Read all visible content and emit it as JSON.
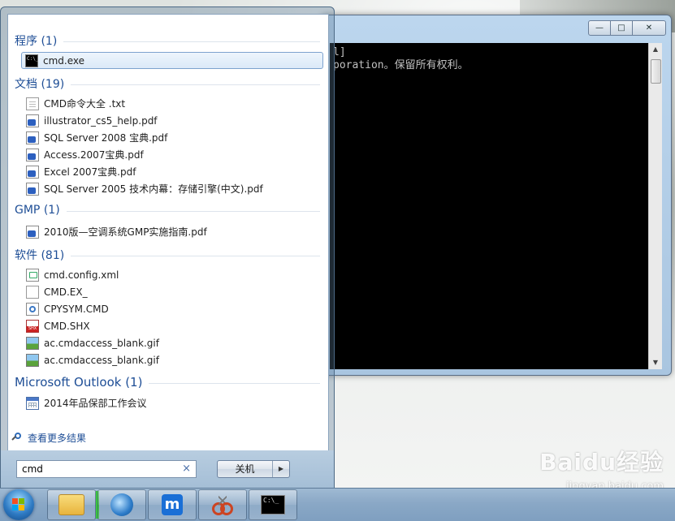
{
  "cmd_window": {
    "console_lines": [
      "l]",
      "poration。保留所有权利。"
    ],
    "controls": [
      "—",
      "□",
      "✕"
    ]
  },
  "start_menu": {
    "groups": [
      {
        "header": "程序 (1)",
        "items": [
          {
            "label": "cmd.exe",
            "icon": "cmd-icon",
            "selected": true
          }
        ]
      },
      {
        "header": "文档 (19)",
        "items": [
          {
            "label": "CMD命令大全 .txt",
            "icon": "text-file-icon"
          },
          {
            "label": "illustrator_cs5_help.pdf",
            "icon": "pdf-file-icon"
          },
          {
            "label": "SQL Server 2008 宝典.pdf",
            "icon": "pdf-file-icon"
          },
          {
            "label": "Access.2007宝典.pdf",
            "icon": "pdf-file-icon"
          },
          {
            "label": "Excel 2007宝典.pdf",
            "icon": "pdf-file-icon"
          },
          {
            "label": "SQL Server 2005 技术内幕：存储引擎(中文).pdf",
            "icon": "pdf-file-icon"
          }
        ]
      },
      {
        "header": "GMP (1)",
        "items": [
          {
            "label": "2010版—空调系统GMP实施指南.pdf",
            "icon": "pdf-file-icon"
          }
        ]
      },
      {
        "header": "软件 (81)",
        "items": [
          {
            "label": "cmd.config.xml",
            "icon": "xml-file-icon"
          },
          {
            "label": "CMD.EX_",
            "icon": "blank-file-icon"
          },
          {
            "label": "CPYSYM.CMD",
            "icon": "cmd-script-icon"
          },
          {
            "label": "CMD.SHX",
            "icon": "shx-file-icon"
          },
          {
            "label": "ac.cmdaccess_blank.gif",
            "icon": "image-file-icon"
          },
          {
            "label": "ac.cmdaccess_blank.gif",
            "icon": "image-file-icon"
          }
        ]
      },
      {
        "header": "Microsoft Outlook (1)",
        "items": [
          {
            "label": "2014年品保部工作会议",
            "icon": "calendar-icon"
          }
        ]
      }
    ],
    "see_more": "查看更多结果",
    "search": {
      "value": "cmd",
      "clear_glyph": "×"
    },
    "shutdown": {
      "label": "关机",
      "arrow": "▶"
    }
  },
  "watermark": {
    "logo": "Baidu经验",
    "url": "jingyan.baidu.com"
  },
  "taskbar": {
    "buttons": [
      "file-explorer-icon",
      "internet-explorer-icon",
      "maxthon-browser-icon",
      "snipping-tool-icon",
      "command-prompt-icon"
    ],
    "maxthon_glyph": "m",
    "cmd_glyph": "C:\\_"
  },
  "colors": {
    "group_header": "#1e4e96",
    "selection_border": "#7da2ce",
    "taskbar": "#8aa8c6"
  }
}
